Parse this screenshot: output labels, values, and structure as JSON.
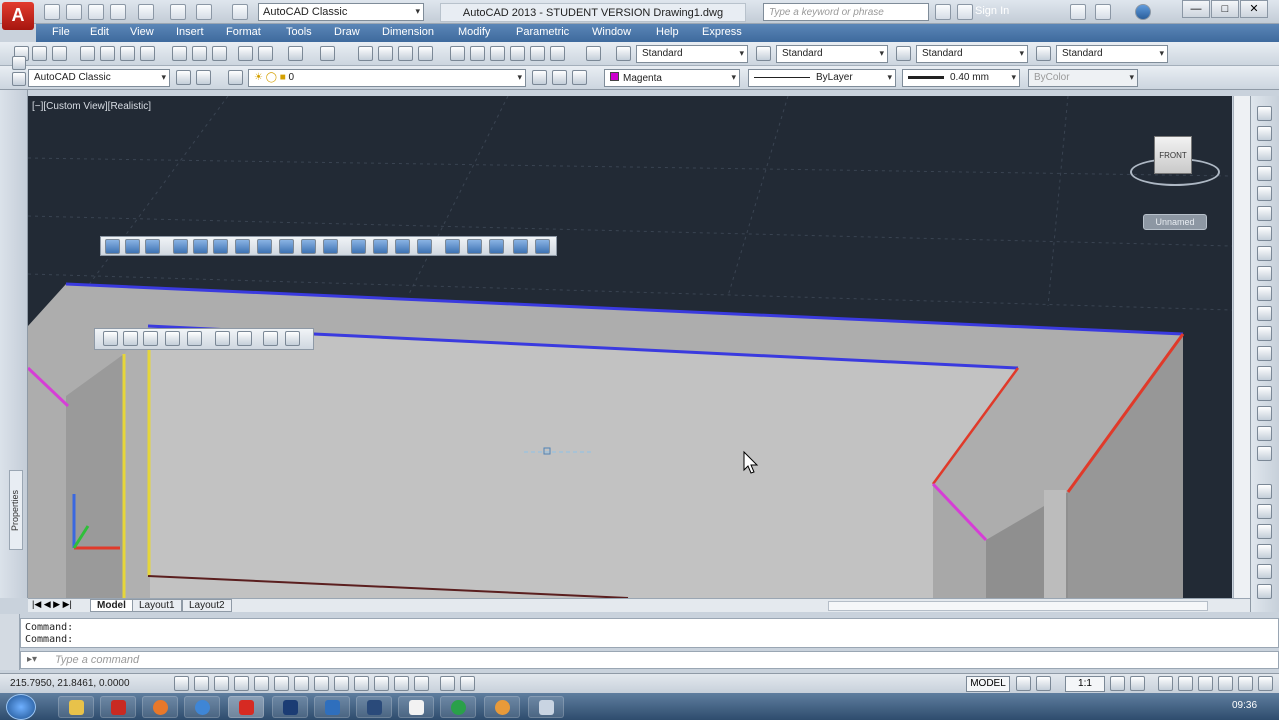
{
  "window": {
    "workspace": "AutoCAD Classic",
    "title": "AutoCAD 2013 - STUDENT VERSION   Drawing1.dwg",
    "search_placeholder": "Type a keyword or phrase",
    "signin": "Sign In",
    "controls": [
      "—",
      "□",
      "✕"
    ]
  },
  "menu": [
    "File",
    "Edit",
    "View",
    "Insert",
    "Format",
    "Tools",
    "Draw",
    "Dimension",
    "Modify",
    "Parametric",
    "Window",
    "Help",
    "Express"
  ],
  "toolbar_styles": {
    "text_style": "Standard",
    "dim_style": "Standard",
    "table_style": "Standard",
    "mleader_style": "Standard"
  },
  "toolbar_layers": {
    "workspace": "AutoCAD Classic",
    "layer": "0",
    "color": "Magenta",
    "color_hex": "#cc00cc",
    "linetype": "ByLayer",
    "lineweight": "0.40 mm",
    "plotstyle": "ByColor"
  },
  "viewport": {
    "label": "[−][Custom View][Realistic]",
    "viewcube_face": "FRONT",
    "ucs_label": "Unnamed"
  },
  "palette": {
    "properties": "Properties"
  },
  "layout_tabs": [
    "Model",
    "Layout1",
    "Layout2"
  ],
  "command": {
    "history": [
      "Command:",
      "Command:"
    ],
    "placeholder": "Type a command"
  },
  "status": {
    "coordinates": "215.7950, 21.8461, 0.0000",
    "model": "MODEL",
    "scale": "1:1"
  },
  "taskbar": {
    "time": "09:36"
  },
  "colors": {
    "viewport_bg": "#222a35",
    "edge_blue": "#3a3adf",
    "edge_red": "#e03a2a",
    "edge_magenta": "#d63ed6",
    "edge_yellow": "#e6d63a"
  }
}
